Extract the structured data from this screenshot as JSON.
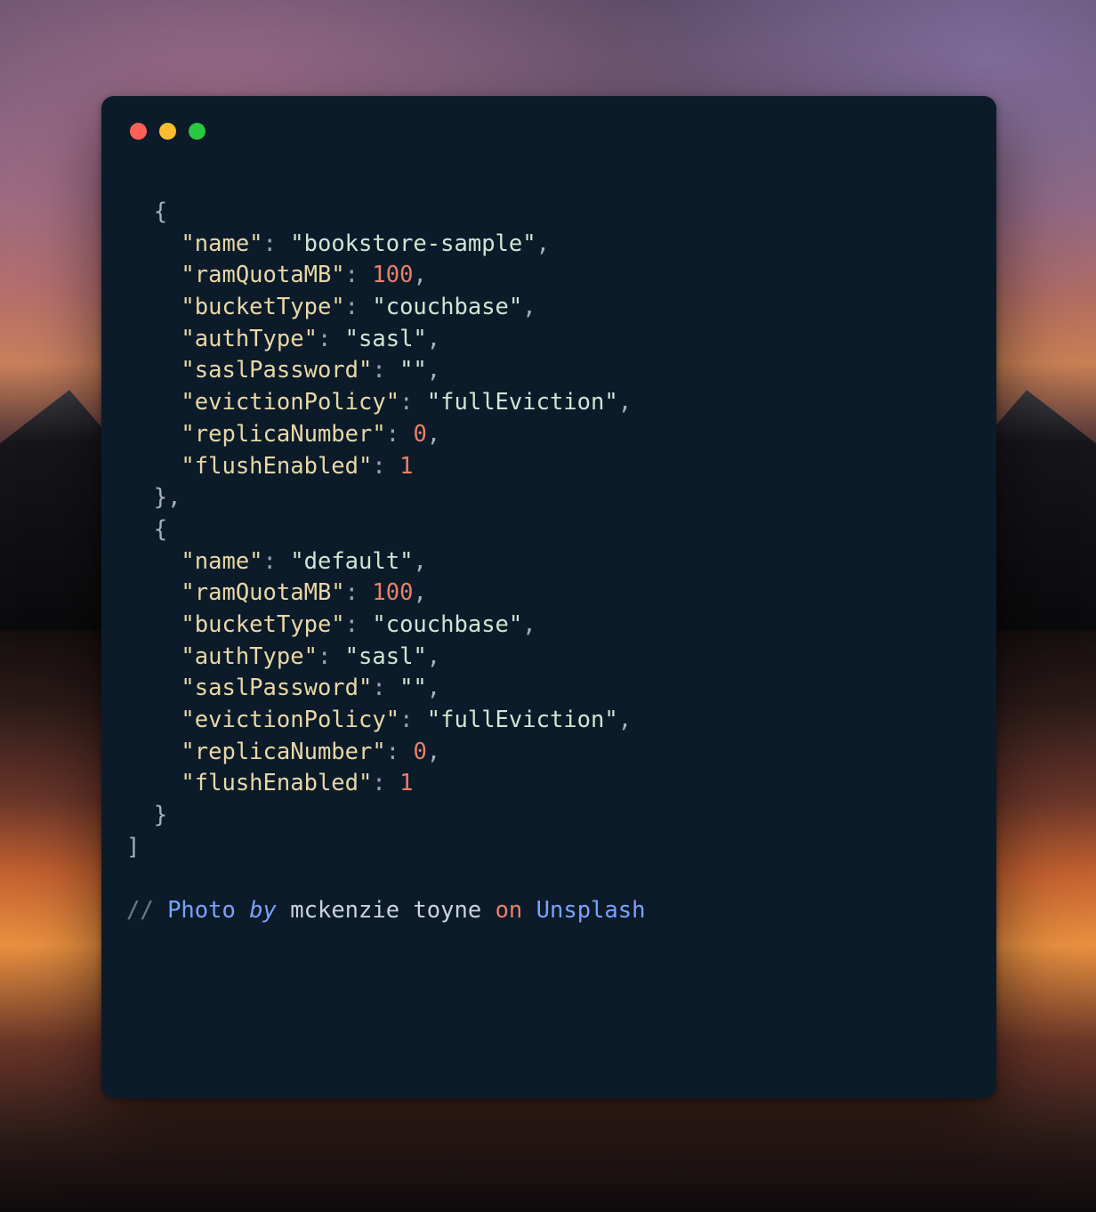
{
  "window": {
    "traffic": {
      "red": "#ff5f57",
      "yellow": "#febc2e",
      "green": "#28c840"
    }
  },
  "code": {
    "buckets": [
      {
        "name": "bookstore-sample",
        "ramQuotaMB": 100,
        "bucketType": "couchbase",
        "authType": "sasl",
        "saslPassword": "",
        "evictionPolicy": "fullEviction",
        "replicaNumber": 0,
        "flushEnabled": 1
      },
      {
        "name": "default",
        "ramQuotaMB": 100,
        "bucketType": "couchbase",
        "authType": "sasl",
        "saslPassword": "",
        "evictionPolicy": "fullEviction",
        "replicaNumber": 0,
        "flushEnabled": 1
      }
    ],
    "indent": "  ",
    "prop_order": [
      "name",
      "ramQuotaMB",
      "bucketType",
      "authType",
      "saslPassword",
      "evictionPolicy",
      "replicaNumber",
      "flushEnabled"
    ],
    "comment": {
      "slashes": "// ",
      "photo": "Photo",
      "by": "by",
      "author": "mckenzie toyne",
      "on": "on",
      "site": "Unsplash"
    }
  },
  "colors": {
    "bg_window": "#0c1b2a",
    "key": "#e8d8a6",
    "string": "#cfe6d2",
    "number": "#e9806a",
    "punct": "#a7b0bd",
    "link": "#7aa2ff"
  }
}
